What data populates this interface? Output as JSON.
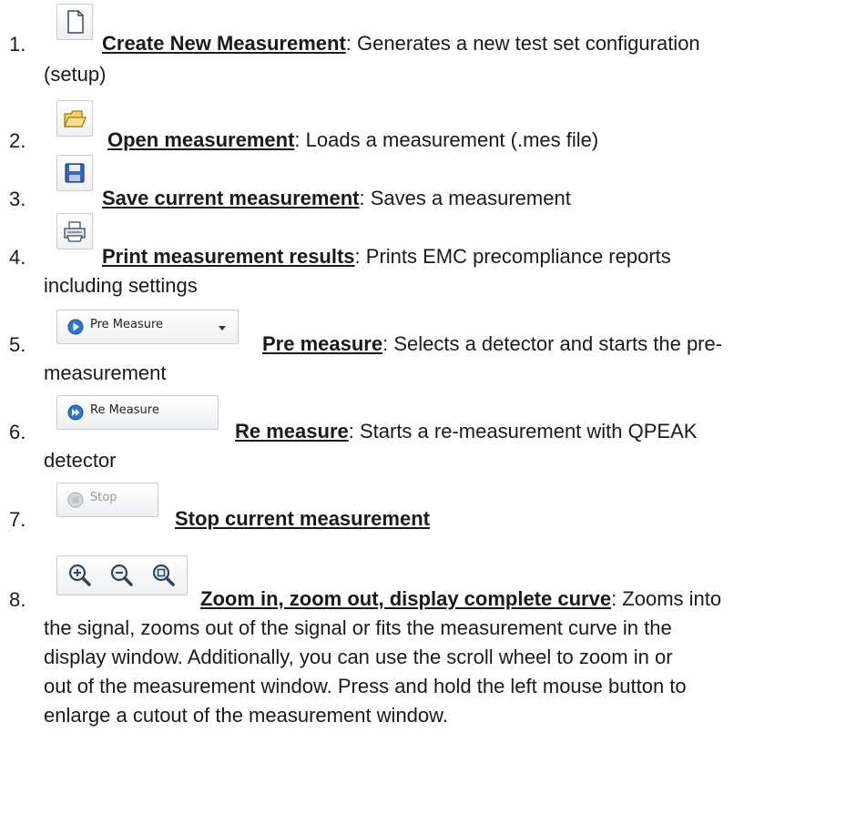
{
  "items": [
    {
      "number": "1.",
      "title": "Create New Measurement",
      "desc_line1": ": Generates a new test set configuration",
      "desc_line2": "(setup)",
      "icon": "new-document-icon"
    },
    {
      "number": "2.",
      "title": "Open measurement",
      "desc_line1": ": Loads a measurement (.mes file)",
      "icon": "open-folder-icon"
    },
    {
      "number": "3.",
      "title": "Save current measurement",
      "desc_line1": ": Saves a measurement",
      "icon": "floppy-disk-icon"
    },
    {
      "number": "4.",
      "title": "Print measurement results",
      "desc_line1": ": Prints EMC precompliance reports",
      "desc_line2": "including settings",
      "icon": "printer-icon"
    },
    {
      "number": "5.",
      "title": "Pre measure",
      "desc_line1": ": Selects a detector and starts the pre-",
      "desc_line2": "measurement",
      "button_label": "Pre Measure",
      "icon": "play-circle-icon"
    },
    {
      "number": "6.",
      "title": "Re measure",
      "desc_line1": ": Starts a re-measurement with QPEAK",
      "desc_line2": "detector",
      "button_label": "Re Measure",
      "icon": "replay-circle-icon"
    },
    {
      "number": "7.",
      "title": "Stop current measurement",
      "button_label": "Stop",
      "icon": "stop-circle-icon"
    },
    {
      "number": "8.",
      "title": "Zoom in, zoom out, display complete curve",
      "desc_line1": ": Zooms into",
      "desc_lines": [
        "the signal, zooms out of the signal or fits the measurement curve in the",
        "display window. Additionally, you can use the scroll wheel to zoom in or",
        "out of the measurement window. Press and hold the left mouse button to",
        "enlarge a cutout of the measurement window."
      ],
      "icons": [
        "zoom-in-icon",
        "zoom-out-icon",
        "zoom-fit-icon"
      ]
    }
  ]
}
